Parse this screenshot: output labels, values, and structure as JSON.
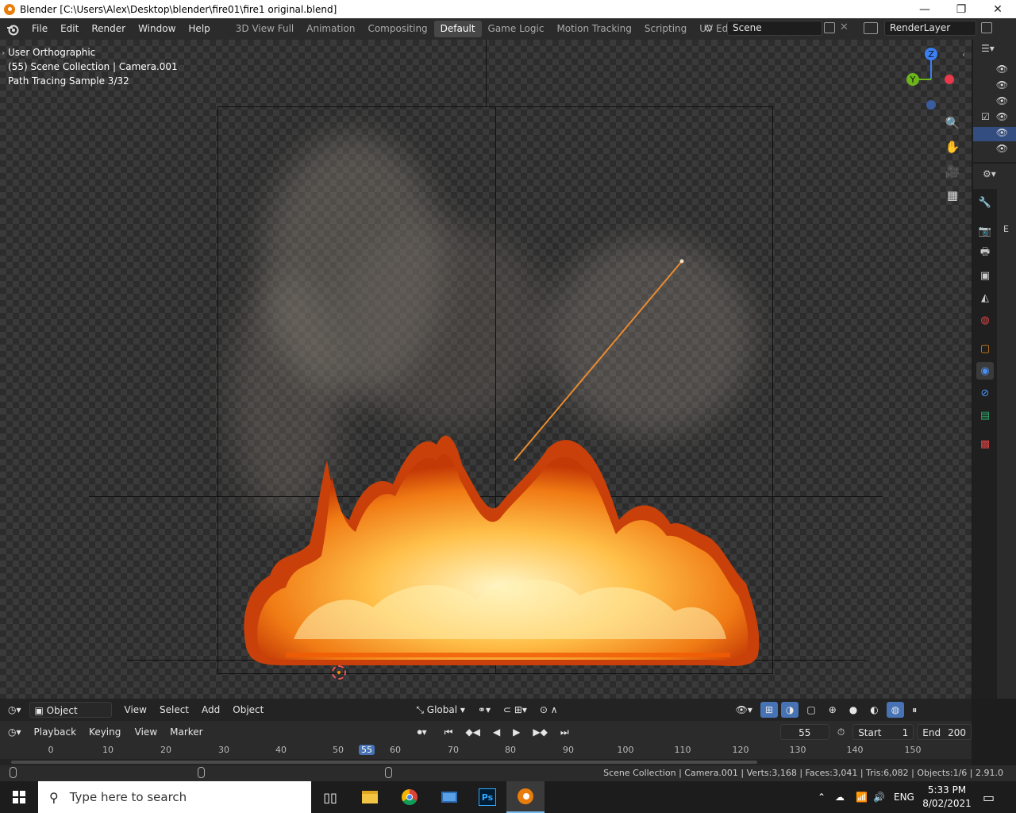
{
  "window": {
    "title": "Blender [C:\\Users\\Alex\\Desktop\\blender\\fire01\\fire1 original.blend]",
    "minimize": "—",
    "maximize": "❐",
    "close": "✕"
  },
  "menu": [
    "File",
    "Edit",
    "Render",
    "Window",
    "Help"
  ],
  "workspaces": [
    "3D View Full",
    "Animation",
    "Compositing",
    "Default",
    "Game Logic",
    "Motion Tracking",
    "Scripting",
    "UV Editing",
    "V"
  ],
  "active_workspace": "Default",
  "scene": {
    "label": "Scene"
  },
  "view_layer": {
    "label": "RenderLayer"
  },
  "viewport": {
    "view_name": "User Orthographic",
    "collection_info": "(55) Scene Collection | Camera.001",
    "render_status": "Path Tracing Sample 3/32",
    "gizmo": {
      "z": "Z",
      "y": "Y"
    }
  },
  "viewport_header": {
    "mode": "Object Mode",
    "menus": [
      "View",
      "Select",
      "Add",
      "Object"
    ],
    "transform_orientation": "Global"
  },
  "timeline": {
    "menus": [
      "Playback",
      "Keying",
      "View",
      "Marker"
    ],
    "current_frame": "55",
    "start_label": "Start",
    "start_value": "1",
    "end_label": "End",
    "end_value": "200",
    "ticks": [
      "0",
      "10",
      "20",
      "30",
      "40",
      "50",
      "55",
      "60",
      "70",
      "80",
      "90",
      "100",
      "110",
      "120",
      "130",
      "140",
      "150"
    ]
  },
  "statusbar": {
    "stats": "Scene Collection | Camera.001 | Verts:3,168 | Faces:3,041 | Tris:6,082 | Objects:1/6 | 2.91.0"
  },
  "properties_panel": {
    "letter": "E"
  },
  "taskbar": {
    "search_placeholder": "Type here to search",
    "language": "ENG",
    "time": "5:33 PM",
    "date": "8/02/2021"
  },
  "colors": {
    "accent": "#4772b3",
    "fire": "#f5a623",
    "axis_x": "#e8394a",
    "axis_y": "#6cb41b",
    "axis_z": "#3a7ff3"
  }
}
